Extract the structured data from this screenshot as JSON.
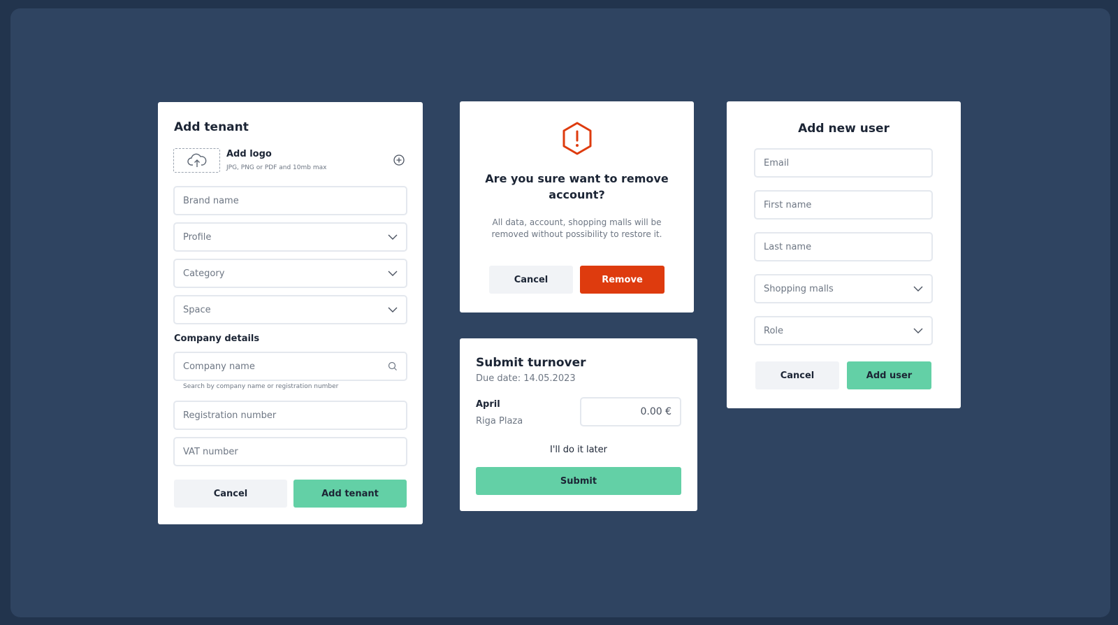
{
  "add_tenant": {
    "title": "Add tenant",
    "logo_label": "Add logo",
    "logo_hint": "JPG, PNG or PDF and 10mb max",
    "brand_placeholder": "Brand name",
    "profile_placeholder": "Profile",
    "category_placeholder": "Category",
    "space_placeholder": "Space",
    "company_section": "Company details",
    "company_placeholder": "Company name",
    "company_hint": "Search by company name or registration number",
    "registration_placeholder": "Registration number",
    "vat_placeholder": "VAT number",
    "cancel_label": "Cancel",
    "submit_label": "Add tenant"
  },
  "remove_dialog": {
    "title": "Are you sure want to remove account?",
    "message": "All data, account, shopping malls will be removed without possibility to restore it.",
    "cancel_label": "Cancel",
    "remove_label": "Remove",
    "icon": "warning-hexagon-icon",
    "accent": "#de3b0e"
  },
  "turnover": {
    "title": "Submit turnover",
    "due": "Due date: 14.05.2023",
    "month": "April",
    "mall": "Riga Plaza",
    "amount": "0.00 €",
    "later_label": "I'll do it later",
    "submit_label": "Submit"
  },
  "add_user": {
    "title": "Add new user",
    "email_placeholder": "Email",
    "first_placeholder": "First name",
    "last_placeholder": "Last name",
    "malls_placeholder": "Shopping malls",
    "role_placeholder": "Role",
    "cancel_label": "Cancel",
    "submit_label": "Add user"
  },
  "colors": {
    "primary": "#63d0a6",
    "danger": "#de3b0e",
    "backdrop": "#2f4461"
  }
}
